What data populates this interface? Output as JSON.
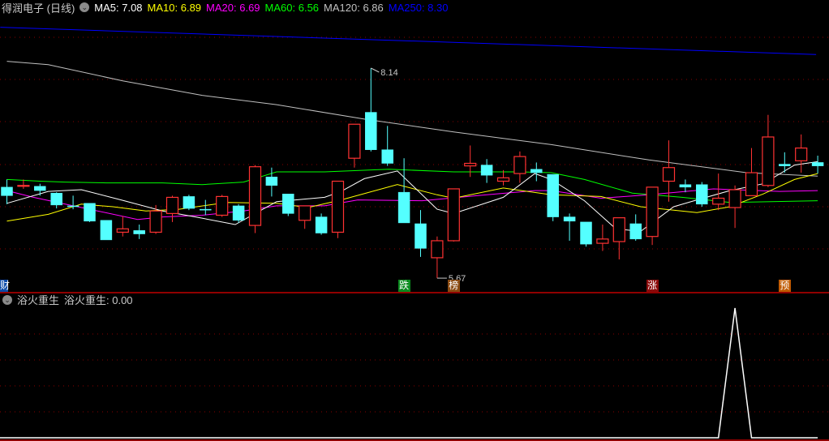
{
  "header": {
    "title": "得润电子 (日线)",
    "ma": [
      {
        "label": "MA5: 7.08",
        "color": "#ffffff"
      },
      {
        "label": "MA10: 6.89",
        "color": "#ffff00"
      },
      {
        "label": "MA20: 6.69",
        "color": "#ff00ff"
      },
      {
        "label": "MA60: 6.56",
        "color": "#00ff00"
      },
      {
        "label": "MA120: 6.86",
        "color": "#c0c0c0"
      },
      {
        "label": "MA250: 8.30",
        "color": "#0000ff"
      }
    ]
  },
  "price_panel": {
    "high_label": "8.14",
    "low_label": "5.67",
    "up_color": "#ff3232",
    "down_color": "#54ffff",
    "candles": [
      [
        6.74,
        6.64,
        6.83,
        6.54
      ],
      [
        6.75,
        6.76,
        6.83,
        6.72
      ],
      [
        6.75,
        6.7,
        6.78,
        6.64
      ],
      [
        6.67,
        6.53,
        6.68,
        6.49
      ],
      [
        6.52,
        6.51,
        6.64,
        6.48
      ],
      [
        6.55,
        6.34,
        6.55,
        6.33
      ],
      [
        6.35,
        6.12,
        6.35,
        6.12
      ],
      [
        6.21,
        6.25,
        6.4,
        6.16
      ],
      [
        6.23,
        6.19,
        6.3,
        6.13
      ],
      [
        6.21,
        6.46,
        6.53,
        6.19
      ],
      [
        6.43,
        6.62,
        6.64,
        6.33
      ],
      [
        6.63,
        6.49,
        6.65,
        6.47
      ],
      [
        6.48,
        6.47,
        6.59,
        6.41
      ],
      [
        6.41,
        6.63,
        6.65,
        6.39
      ],
      [
        6.52,
        6.35,
        6.54,
        6.32
      ],
      [
        6.29,
        6.98,
        7.0,
        6.2
      ],
      [
        6.86,
        6.76,
        6.97,
        6.63
      ],
      [
        6.66,
        6.43,
        6.66,
        6.4
      ],
      [
        6.35,
        6.52,
        6.52,
        6.25
      ],
      [
        6.39,
        6.2,
        6.43,
        6.18
      ],
      [
        6.21,
        6.81,
        6.81,
        6.14
      ],
      [
        7.08,
        7.48,
        7.48,
        6.97
      ],
      [
        7.62,
        7.18,
        8.14,
        7.16
      ],
      [
        7.18,
        7.02,
        7.46,
        6.99
      ],
      [
        6.68,
        6.32,
        7.08,
        6.32
      ],
      [
        6.31,
        6.02,
        6.47,
        5.92
      ],
      [
        5.91,
        6.11,
        6.16,
        5.67
      ],
      [
        6.11,
        6.72,
        6.72,
        6.1
      ],
      [
        6.99,
        7.02,
        7.23,
        6.86
      ],
      [
        7.0,
        6.88,
        7.07,
        6.79
      ],
      [
        6.81,
        6.85,
        6.94,
        6.76
      ],
      [
        6.9,
        7.1,
        7.16,
        6.79
      ],
      [
        6.95,
        6.91,
        7.03,
        6.81
      ],
      [
        6.89,
        6.39,
        6.89,
        6.34
      ],
      [
        6.39,
        6.34,
        6.43,
        6.11
      ],
      [
        6.33,
        6.07,
        6.33,
        6.04
      ],
      [
        6.08,
        6.13,
        6.3,
        5.99
      ],
      [
        6.1,
        6.38,
        6.38,
        5.89
      ],
      [
        6.31,
        6.13,
        6.42,
        6.11
      ],
      [
        6.16,
        6.74,
        6.74,
        6.06
      ],
      [
        6.81,
        6.97,
        7.29,
        6.57
      ],
      [
        6.77,
        6.74,
        6.83,
        6.68
      ],
      [
        6.77,
        6.54,
        6.8,
        6.51
      ],
      [
        6.54,
        6.61,
        6.9,
        6.47
      ],
      [
        6.5,
        6.71,
        6.76,
        6.26
      ],
      [
        6.64,
        6.91,
        7.2,
        6.64
      ],
      [
        6.76,
        7.33,
        7.59,
        6.74
      ],
      [
        7.01,
        6.99,
        7.15,
        6.91
      ],
      [
        7.05,
        7.2,
        7.36,
        6.91
      ],
      [
        7.03,
        6.99,
        7.11,
        6.9
      ]
    ],
    "ma_lines": [
      {
        "name": "MA250",
        "color": "#0000ff",
        "points": [
          [
            -0.4,
            8.62
          ],
          [
            48.9,
            8.3
          ]
        ]
      },
      {
        "name": "MA120",
        "color": "#c0c0c0",
        "points": [
          [
            0,
            8.22
          ],
          [
            2.5,
            8.18
          ],
          [
            7,
            7.99
          ],
          [
            11.8,
            7.82
          ],
          [
            16.3,
            7.71
          ],
          [
            21.6,
            7.54
          ],
          [
            27,
            7.39
          ],
          [
            32.9,
            7.24
          ],
          [
            38.8,
            7.06
          ],
          [
            44.7,
            6.91
          ],
          [
            49,
            6.87
          ]
        ]
      },
      {
        "name": "MA60",
        "color": "#00ff00",
        "points": [
          [
            0,
            6.83
          ],
          [
            2,
            6.81
          ],
          [
            3.5,
            6.8
          ],
          [
            6,
            6.79
          ],
          [
            9.4,
            6.79
          ],
          [
            11.8,
            6.77
          ],
          [
            14.3,
            6.8
          ],
          [
            16.3,
            6.92
          ],
          [
            19.2,
            6.92
          ],
          [
            23.1,
            6.95
          ],
          [
            27,
            6.92
          ],
          [
            31,
            6.92
          ],
          [
            32.9,
            6.91
          ],
          [
            34.9,
            6.83
          ],
          [
            37.8,
            6.67
          ],
          [
            40.8,
            6.62
          ],
          [
            43.7,
            6.56
          ],
          [
            49,
            6.58
          ]
        ]
      },
      {
        "name": "MA20",
        "color": "#ff00ff",
        "points": [
          [
            0,
            6.7
          ],
          [
            1.6,
            6.62
          ],
          [
            4.5,
            6.5
          ],
          [
            7.9,
            6.36
          ],
          [
            9.4,
            6.39
          ],
          [
            11.8,
            6.41
          ],
          [
            14.3,
            6.46
          ],
          [
            16.3,
            6.52
          ],
          [
            19.2,
            6.52
          ],
          [
            21.2,
            6.59
          ],
          [
            25.1,
            6.58
          ],
          [
            29,
            6.65
          ],
          [
            31.9,
            6.7
          ],
          [
            32.9,
            6.7
          ],
          [
            35.9,
            6.61
          ],
          [
            38.8,
            6.65
          ],
          [
            42.7,
            6.72
          ],
          [
            46.7,
            6.69
          ],
          [
            49,
            6.7
          ]
        ]
      },
      {
        "name": "MA10",
        "color": "#ffff00",
        "points": [
          [
            0,
            6.34
          ],
          [
            2.5,
            6.42
          ],
          [
            4.5,
            6.54
          ],
          [
            6.4,
            6.51
          ],
          [
            8.4,
            6.46
          ],
          [
            10.4,
            6.48
          ],
          [
            13.3,
            6.56
          ],
          [
            16.3,
            6.55
          ],
          [
            18.2,
            6.5
          ],
          [
            20.2,
            6.59
          ],
          [
            23.6,
            6.77
          ],
          [
            26,
            6.65
          ],
          [
            27,
            6.61
          ],
          [
            30,
            6.73
          ],
          [
            32.9,
            6.65
          ],
          [
            35.9,
            6.63
          ],
          [
            38.3,
            6.51
          ],
          [
            41.7,
            6.44
          ],
          [
            43.7,
            6.51
          ],
          [
            45.7,
            6.66
          ],
          [
            47.6,
            6.83
          ],
          [
            49,
            6.9
          ]
        ]
      },
      {
        "name": "MA5",
        "color": "#ffffff",
        "points": [
          [
            0,
            6.55
          ],
          [
            2.5,
            6.69
          ],
          [
            4.5,
            6.71
          ],
          [
            6.9,
            6.59
          ],
          [
            9.4,
            6.46
          ],
          [
            11.4,
            6.39
          ],
          [
            13.8,
            6.3
          ],
          [
            16.3,
            6.57
          ],
          [
            19.2,
            6.62
          ],
          [
            20.2,
            6.69
          ],
          [
            21.6,
            6.84
          ],
          [
            23.6,
            6.93
          ],
          [
            26,
            6.48
          ],
          [
            27,
            6.43
          ],
          [
            30,
            6.62
          ],
          [
            31.9,
            6.9
          ],
          [
            32.9,
            6.83
          ],
          [
            34.9,
            6.58
          ],
          [
            36.8,
            6.25
          ],
          [
            38.3,
            6.22
          ],
          [
            40.3,
            6.51
          ],
          [
            41.7,
            6.59
          ],
          [
            43.7,
            6.7
          ],
          [
            45.7,
            6.78
          ],
          [
            47.6,
            7.0
          ],
          [
            49,
            7.04
          ]
        ]
      }
    ],
    "event_markers": [
      {
        "index": 0,
        "label": "财",
        "color": "#0a4aa8"
      },
      {
        "index": 24,
        "label": "跌",
        "color": "#0a8a1e"
      },
      {
        "index": 27,
        "label": "榜",
        "color": "#8a4a10"
      },
      {
        "index": 39,
        "label": "涨",
        "color": "#8a0a0a"
      },
      {
        "index": 47,
        "label": "预",
        "color": "#c05a00"
      }
    ]
  },
  "indicator_panel": {
    "title": "浴火重生",
    "value_label": "浴火重生: 0.00",
    "line_color": "#ffffff",
    "spike_index": 44,
    "values_range": [
      0,
      1
    ]
  }
}
